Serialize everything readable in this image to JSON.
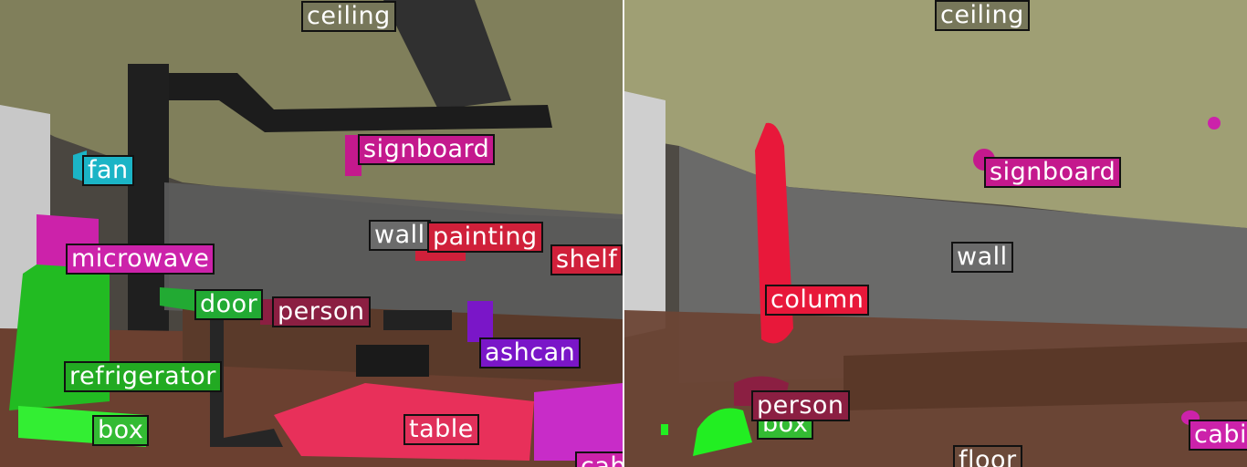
{
  "colors": {
    "ceiling": "#77775a",
    "signboard": "#c4198d",
    "wall": "#6b6b6b",
    "painting": "#d0203a",
    "shelf": "#d0203a",
    "person": "#8b1f42",
    "fan": "#1bb4c6",
    "microwave": "#cc22aa",
    "door": "#22aa33",
    "refrigerator": "#22aa22",
    "box": "#33bb33",
    "table": "#e0305a",
    "ashcan": "#7a16c8",
    "column": "#e8183a",
    "floor": "#6b4a3a",
    "cabinet": "#cc22aa"
  },
  "left_panel": {
    "labels": {
      "ceiling": "ceiling",
      "signboard": "signboard",
      "fan": "fan",
      "wall": "wall",
      "painting": "painting",
      "shelf": "shelf",
      "microwave": "microwave",
      "door": "door",
      "person": "person",
      "ashcan": "ashcan",
      "refrigerator": "refrigerator",
      "box": "box",
      "table": "table",
      "cab": "cab"
    }
  },
  "right_panel": {
    "labels": {
      "ceiling": "ceiling",
      "signboard": "signboard",
      "wall": "wall",
      "column": "column",
      "person": "person",
      "box": "box",
      "floor": "floor",
      "cabinet": "cabi"
    }
  }
}
